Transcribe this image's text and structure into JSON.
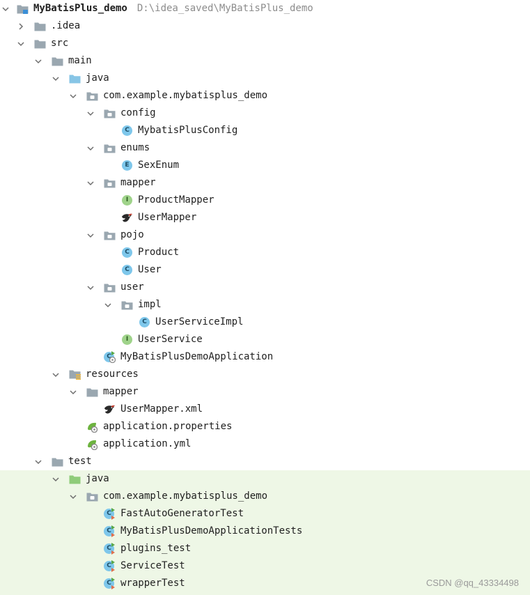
{
  "project": {
    "name": "MyBatisPlus_demo",
    "path": "D:\\idea_saved\\MyBatisPlus_demo"
  },
  "tree": [
    {
      "label": "MyBatisPlus_demo",
      "depth": 0,
      "icon": "module-folder-icon",
      "chevron": "down",
      "bold": true,
      "has_path": true
    },
    {
      "label": ".idea",
      "depth": 1,
      "icon": "folder-icon",
      "chevron": "right"
    },
    {
      "label": "src",
      "depth": 1,
      "icon": "folder-icon",
      "chevron": "down"
    },
    {
      "label": "main",
      "depth": 2,
      "icon": "folder-icon",
      "chevron": "down"
    },
    {
      "label": "java",
      "depth": 3,
      "icon": "source-root-folder-icon",
      "chevron": "down"
    },
    {
      "label": "com.example.mybatisplus_demo",
      "depth": 4,
      "icon": "package-icon",
      "chevron": "down"
    },
    {
      "label": "config",
      "depth": 5,
      "icon": "package-icon",
      "chevron": "down"
    },
    {
      "label": "MybatisPlusConfig",
      "depth": 6,
      "icon": "class-icon"
    },
    {
      "label": "enums",
      "depth": 5,
      "icon": "package-icon",
      "chevron": "down"
    },
    {
      "label": "SexEnum",
      "depth": 6,
      "icon": "enum-icon"
    },
    {
      "label": "mapper",
      "depth": 5,
      "icon": "package-icon",
      "chevron": "down"
    },
    {
      "label": "ProductMapper",
      "depth": 6,
      "icon": "interface-icon"
    },
    {
      "label": "UserMapper",
      "depth": 6,
      "icon": "mybatis-bird-icon"
    },
    {
      "label": "pojo",
      "depth": 5,
      "icon": "package-icon",
      "chevron": "down"
    },
    {
      "label": "Product",
      "depth": 6,
      "icon": "class-icon"
    },
    {
      "label": "User",
      "depth": 6,
      "icon": "class-icon"
    },
    {
      "label": "user",
      "depth": 5,
      "icon": "package-icon",
      "chevron": "down"
    },
    {
      "label": "impl",
      "depth": 6,
      "icon": "package-icon",
      "chevron": "down"
    },
    {
      "label": "UserServiceImpl",
      "depth": 7,
      "icon": "class-icon"
    },
    {
      "label": "UserService",
      "depth": 6,
      "icon": "interface-icon"
    },
    {
      "label": "MyBatisPlusDemoApplication",
      "depth": 5,
      "icon": "spring-boot-class-icon"
    },
    {
      "label": "resources",
      "depth": 3,
      "icon": "resources-root-folder-icon",
      "chevron": "down"
    },
    {
      "label": "mapper",
      "depth": 4,
      "icon": "folder-icon",
      "chevron": "down"
    },
    {
      "label": "UserMapper.xml",
      "depth": 5,
      "icon": "mybatis-bird-icon"
    },
    {
      "label": "application.properties",
      "depth": 4,
      "icon": "spring-config-icon"
    },
    {
      "label": "application.yml",
      "depth": 4,
      "icon": "spring-config-icon"
    },
    {
      "label": "test",
      "depth": 2,
      "icon": "folder-icon",
      "chevron": "down"
    },
    {
      "label": "java",
      "depth": 3,
      "icon": "test-root-folder-icon",
      "chevron": "down",
      "test_scope": true
    },
    {
      "label": "com.example.mybatisplus_demo",
      "depth": 4,
      "icon": "package-icon",
      "chevron": "down",
      "test_scope": true
    },
    {
      "label": "FastAutoGeneratorTest",
      "depth": 5,
      "icon": "test-class-icon",
      "test_scope": true
    },
    {
      "label": "MyBatisPlusDemoApplicationTests",
      "depth": 5,
      "icon": "test-class-icon",
      "test_scope": true
    },
    {
      "label": "plugins_test",
      "depth": 5,
      "icon": "test-class-icon",
      "test_scope": true
    },
    {
      "label": "ServiceTest",
      "depth": 5,
      "icon": "test-class-icon",
      "test_scope": true
    },
    {
      "label": "wrapperTest",
      "depth": 5,
      "icon": "test-class-icon",
      "test_scope": true
    }
  ],
  "badges": {
    "class": "C",
    "enum": "E",
    "interface": "I"
  },
  "watermark": "CSDN @qq_43334498",
  "colors": {
    "folder": "#9aa7b0",
    "source_root": "#87c5e6",
    "test_root": "#8fcc7a",
    "test_scope_bg": "#eef7e6",
    "path_text": "#8c8c8c"
  }
}
